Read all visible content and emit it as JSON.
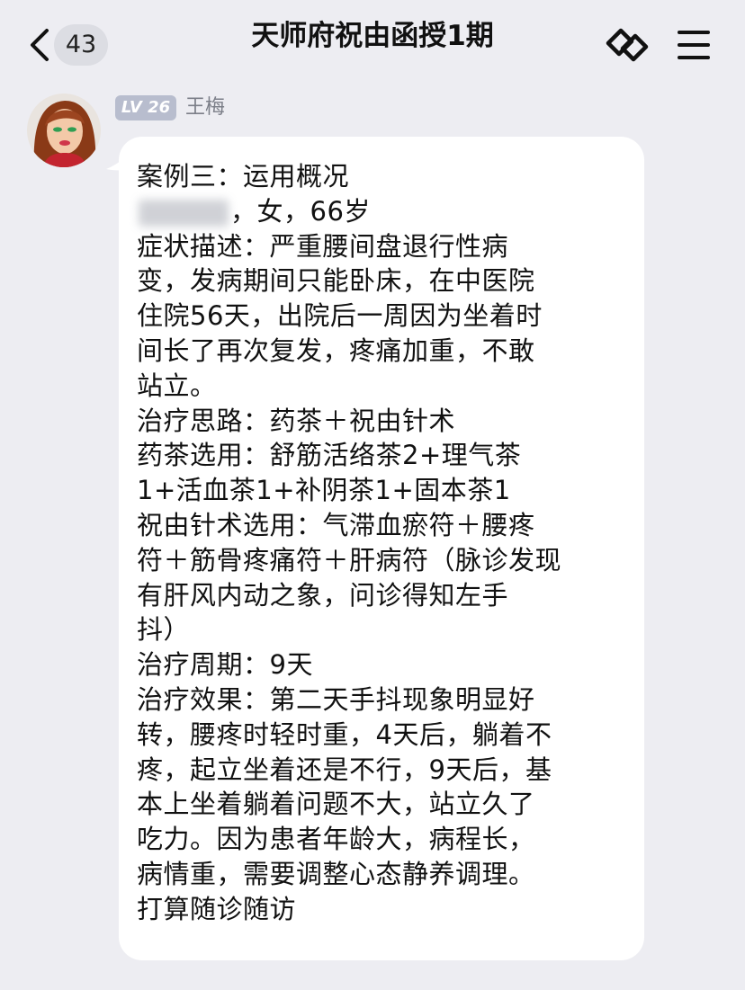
{
  "nav": {
    "unread_count": "43",
    "title": "天师府祝由函授1期"
  },
  "sender": {
    "level": "LV 26",
    "name": "王梅"
  },
  "message": {
    "lines": [
      "案例三：运用概况",
      "，女，66岁",
      "症状描述：严重腰间盘退行性病",
      "变，发病期间只能卧床，在中医院",
      "住院56天，出院后一周因为坐着时",
      "间长了再次复发，疼痛加重，不敢",
      "站立。",
      "治疗思路：药茶＋祝由针术",
      "药茶选用：舒筋活络茶2+理气茶",
      "1+活血茶1+补阴茶1+固本茶1",
      "祝由针术选用：气滞血瘀符＋腰疼",
      "符＋筋骨疼痛符＋肝病符（脉诊发现",
      "有肝风内动之象，问诊得知左手",
      "抖）",
      "治疗周期：9天",
      "治疗效果：第二天手抖现象明显好",
      "转，腰疼时轻时重，4天后，躺着不",
      "疼，起立坐着还是不行，9天后，基",
      "本上坐着躺着问题不大，站立久了",
      "吃力。因为患者年龄大，病程长，",
      "病情重，需要调整心态静养调理。",
      "打算随诊随访"
    ]
  },
  "colors": {
    "background": "#ededf2",
    "bubble": "#ffffff",
    "level_badge": "#b8bdce",
    "name_text": "#7b7e88"
  },
  "icons": {
    "back": "chevron-left-icon",
    "link": "link-icon",
    "menu": "hamburger-menu-icon"
  }
}
